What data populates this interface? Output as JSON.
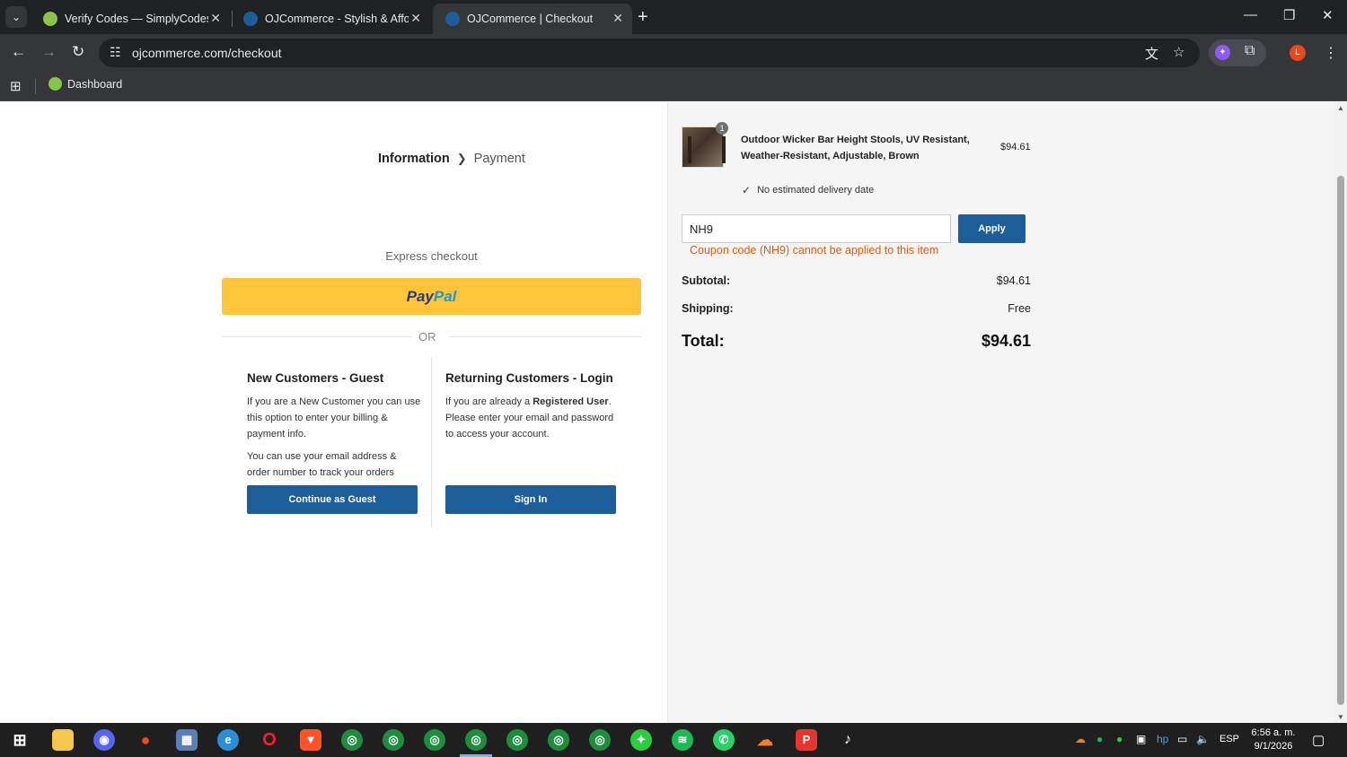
{
  "browser": {
    "tabs": [
      {
        "title": "Verify Codes — SimplyCodes",
        "active": false
      },
      {
        "title": "OJCommerce - Stylish & Afford",
        "active": false
      },
      {
        "title": "OJCommerce | Checkout",
        "active": true
      }
    ],
    "url": "ojcommerce.com/checkout",
    "bookmarks": [
      {
        "label": "Dashboard"
      }
    ],
    "profile_initial": "L"
  },
  "checkout": {
    "steps": {
      "current": "Information",
      "next": "Payment"
    },
    "express_label": "Express checkout",
    "paypal": {
      "part1": "Pay",
      "part2": "Pal"
    },
    "or_label": "OR",
    "guest": {
      "title": "New Customers - Guest",
      "text1": "If you are a New Customer you can use this option to enter your billing & payment info.",
      "text2": "You can use your email address & order number to track your orders",
      "button": "Continue as Guest"
    },
    "login": {
      "title": "Returning Customers - Login",
      "text_pre": "If you are already a ",
      "text_bold": "Registered User",
      "text_post": ". Please enter your email and password to access your account.",
      "button": "Sign In"
    }
  },
  "order_summary": {
    "item": {
      "quantity": "1",
      "name": "Outdoor Wicker Bar Height Stools, UV Resistant, Weather-Resistant, Adjustable, Brown",
      "price": "$94.61",
      "delivery": "No estimated delivery date"
    },
    "coupon": {
      "value": "NH9",
      "button": "Apply",
      "error": "Coupon code (NH9) cannot be applied to this item"
    },
    "subtotal_label": "Subtotal:",
    "subtotal_value": "$94.61",
    "shipping_label": "Shipping:",
    "shipping_value": "Free",
    "total_label": "Total:",
    "total_value": "$94.61"
  },
  "taskbar": {
    "language": "ESP",
    "time": "6:56 a. m.",
    "date": "9/1/2026"
  },
  "colors": {
    "accent_blue": "#1d5e9a",
    "paypal_yellow": "#ffc439",
    "error_orange": "#e05a12"
  }
}
